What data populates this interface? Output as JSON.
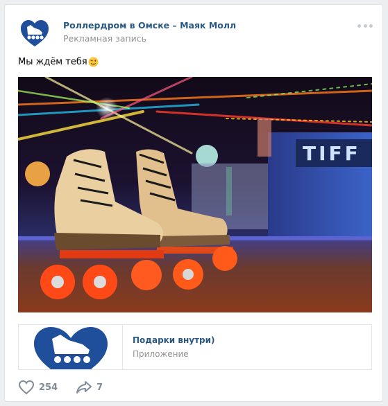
{
  "post": {
    "author": "Роллердром в Омске – Маяк Молл",
    "label": "Рекламная запись",
    "text": "Мы ждём тебя",
    "text_emoji": "wink-emoji",
    "more_icon": "more-dots-icon"
  },
  "snippet": {
    "title": "Подарки внутри)",
    "subtitle": "Приложение"
  },
  "actions": {
    "likes": "254",
    "like_icon": "heart-icon",
    "shares": "7",
    "share_icon": "share-arrow-icon"
  },
  "colors": {
    "brand_blue": "#1f4f9a",
    "link": "#2a5885",
    "muted": "#939393",
    "action_gray": "#818c99"
  }
}
